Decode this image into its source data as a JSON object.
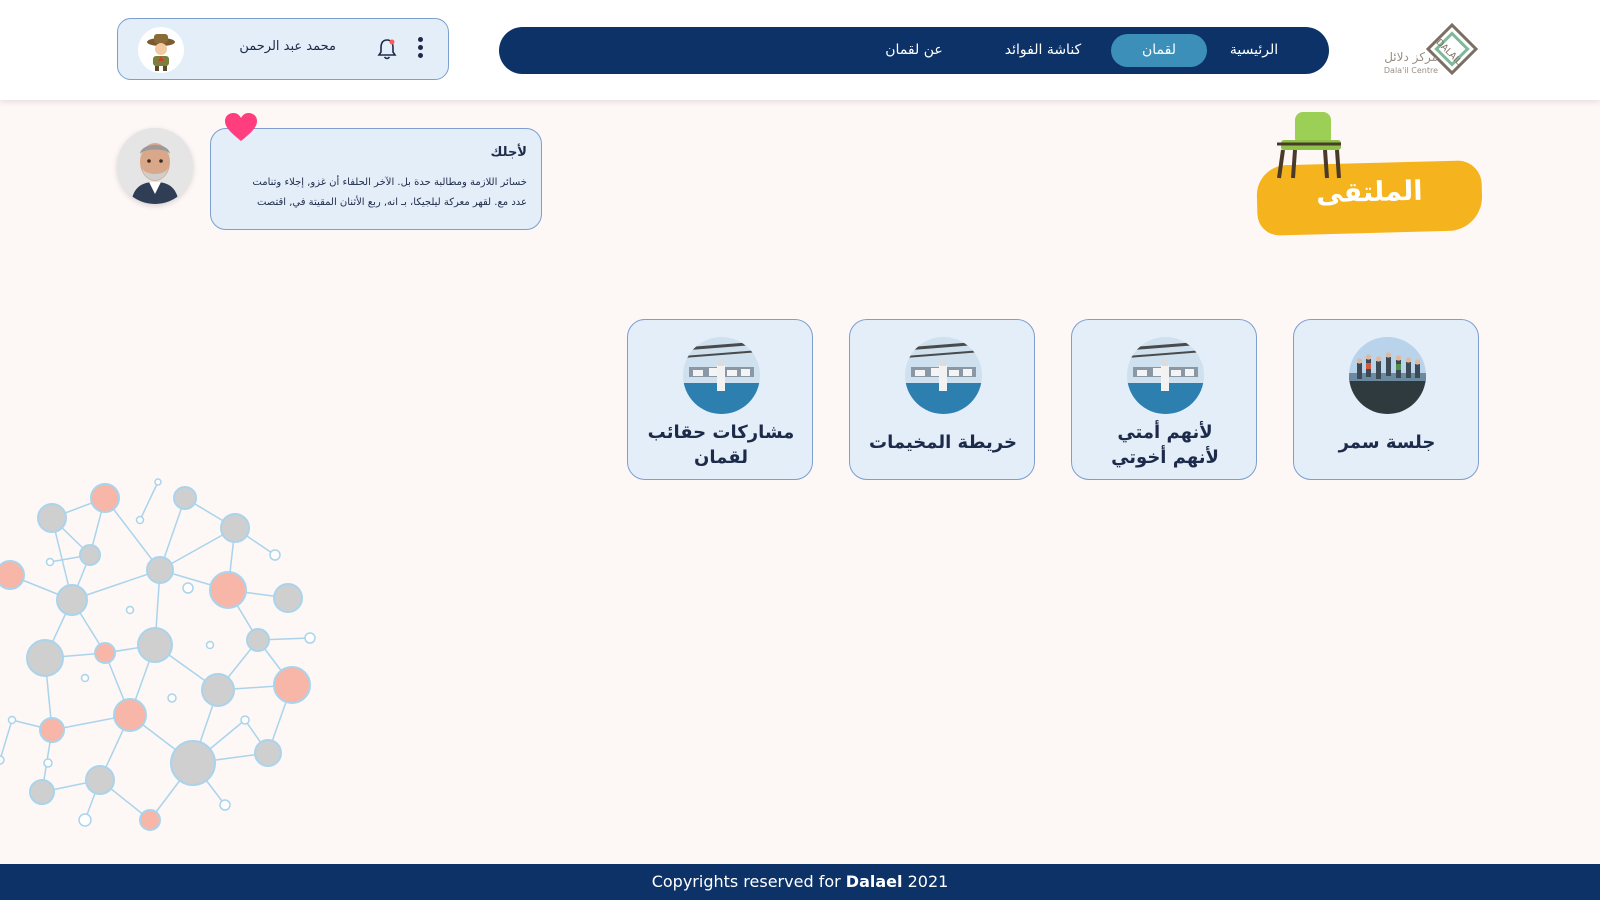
{
  "brand": {
    "logo_ar": "مركز دلائل",
    "logo_en": "Dala'il Centre",
    "logo_mark_text": "DALAIL",
    "colors": {
      "navy": "#0c3268",
      "accent": "#3b8fb8",
      "badge": "#f5b41e",
      "card_bg": "#e4eef9",
      "heart": "#ff3d7f"
    }
  },
  "nav": {
    "items": [
      {
        "label": "الرئيسية",
        "active": false
      },
      {
        "label": "لقمان",
        "active": true
      },
      {
        "label": "كناشة الفوائد",
        "active": false
      },
      {
        "label": "عن لقمان",
        "active": false
      }
    ]
  },
  "user": {
    "name": "محمد عبد الرحمن",
    "icons": [
      "scout-avatar-icon",
      "bell-icon",
      "kebab-menu-icon"
    ]
  },
  "page": {
    "title": "الملتقى",
    "title_icon": "armchair-icon"
  },
  "quote": {
    "title": "لأجلك",
    "line1": "خسائر اللازمة ومطالبة حدة بل. الآخر الحلفاء أن غزو, إجلاء وتنامت",
    "line2": "عدد مع. لقهر معركة ليلجيكا، بـ انه, ربع الأثنان المقيتة في, اقتصت",
    "icons": [
      "heart-icon",
      "man-avatar-icon"
    ]
  },
  "cards": [
    {
      "label": "جلسة سمر",
      "image": "group-jumping-photo"
    },
    {
      "label": "لأنهم أمتي لأنهم أخوتي",
      "line1": "لأنهم أمتي",
      "line2": "لأنهم أخوتي",
      "image": "harbor-photo"
    },
    {
      "label": "خريطة المخيمات",
      "image": "harbor-photo"
    },
    {
      "label": "مشاركات حقائب لقمان",
      "line1": "مشاركات حقائب",
      "line2": "لقمان",
      "image": "harbor-photo"
    }
  ],
  "footer": {
    "prefix": "Copyrights reserved for",
    "brand": "Dalael",
    "year": "2021"
  }
}
